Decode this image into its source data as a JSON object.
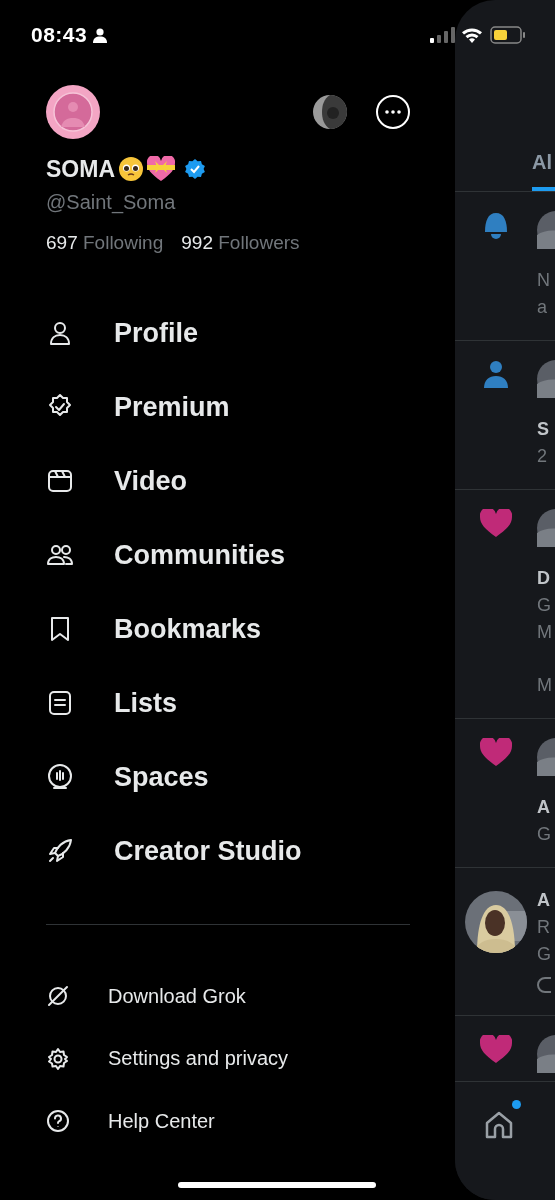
{
  "status_bar": {
    "time": "08:43"
  },
  "profile": {
    "name": "SOMA",
    "handle": "@Saint_Soma",
    "verified": true,
    "following_count": "697",
    "following_label": "Following",
    "followers_count": "992",
    "followers_label": "Followers"
  },
  "menu_items": [
    {
      "label": "Profile"
    },
    {
      "label": "Premium"
    },
    {
      "label": "Video"
    },
    {
      "label": "Communities"
    },
    {
      "label": "Bookmarks"
    },
    {
      "label": "Lists"
    },
    {
      "label": "Spaces"
    },
    {
      "label": "Creator Studio"
    }
  ],
  "secondary_items": [
    {
      "label": "Download Grok"
    },
    {
      "label": "Settings and privacy"
    },
    {
      "label": "Help Center"
    }
  ],
  "feed_panel": {
    "tab": {
      "label": "Al",
      "selected": true
    },
    "rows": [
      {
        "kind": "bell",
        "lines": [
          {
            "kind": "text",
            "text": "N"
          },
          {
            "kind": "text",
            "text": "a"
          }
        ]
      },
      {
        "kind": "person",
        "lines": [
          {
            "kind": "name",
            "text": "S"
          },
          {
            "kind": "text",
            "text": "2"
          }
        ]
      },
      {
        "kind": "heart",
        "lines": [
          {
            "kind": "name",
            "text": "D"
          },
          {
            "kind": "text",
            "text": "G"
          },
          {
            "kind": "text",
            "text": "M"
          },
          {
            "kind": "meta",
            "text": "M"
          }
        ]
      },
      {
        "kind": "heart",
        "lines": [
          {
            "kind": "name",
            "text": "A"
          },
          {
            "kind": "text",
            "text": "G"
          }
        ]
      },
      {
        "kind": "avatar",
        "lines": [
          {
            "kind": "name",
            "text": "A"
          },
          {
            "kind": "text",
            "text": "R"
          },
          {
            "kind": "text",
            "text": "G"
          },
          {
            "kind": "reply"
          }
        ]
      },
      {
        "kind": "heart"
      }
    ],
    "home_unread": true
  }
}
